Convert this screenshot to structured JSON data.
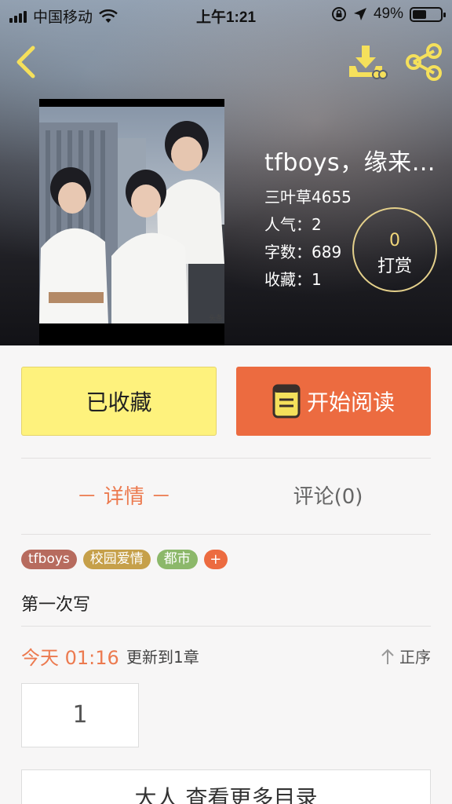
{
  "status_bar": {
    "carrier": "中国移动",
    "time": "上午1:21",
    "battery_percent": "49%",
    "battery_level": 0.49
  },
  "icons": {
    "back": "chevron-left-icon",
    "download": "download-icon",
    "share": "share-icon",
    "read": "book-icon",
    "order": "arrow-up-icon"
  },
  "book": {
    "title": "tfboys，缘来…",
    "author": "三叶草4655",
    "popularity": "人气：2",
    "word_count": "字数：689",
    "favorites": "收藏：1"
  },
  "reward": {
    "count": "0",
    "label": "打赏"
  },
  "actions": {
    "collected_label": "已收藏",
    "read_label": "开始阅读"
  },
  "tabs": {
    "detail": "－ 详情 －",
    "comments": "评论(0)"
  },
  "tags": [
    {
      "label": "tfboys",
      "color": "#b76b5e"
    },
    {
      "label": "校园爱情",
      "color": "#c6a04a"
    },
    {
      "label": "都市",
      "color": "#8cb86a"
    }
  ],
  "tag_add": "+",
  "description": "第一次写",
  "update": {
    "when": "今天 01:16",
    "text": "更新到1章",
    "order_label": "正序"
  },
  "chapters": [
    "1"
  ],
  "more_catalog": "大人 查看更多目录",
  "colors": {
    "accent": "#ec6b40",
    "collected_bg": "#fef27d",
    "reward_ring": "#e4d08b"
  }
}
